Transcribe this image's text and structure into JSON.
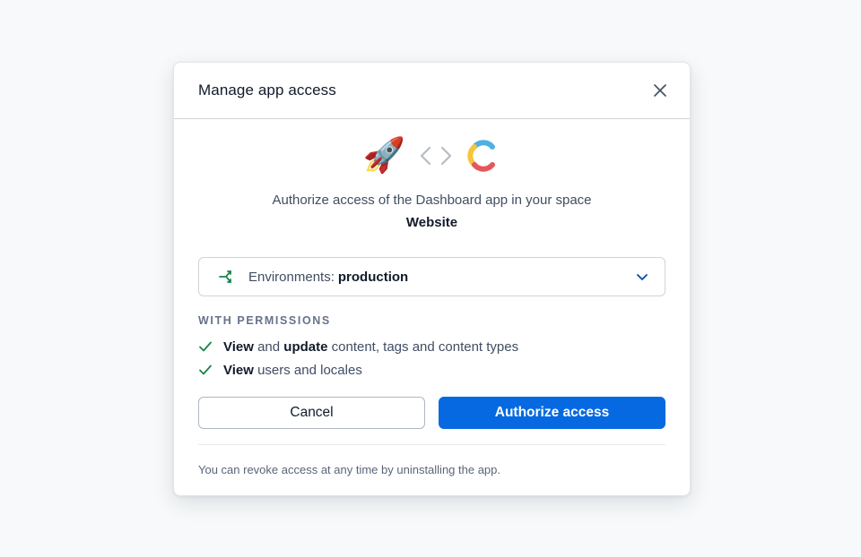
{
  "modal": {
    "title": "Manage app access",
    "close_icon": "close-icon"
  },
  "logos": {
    "app_icon": "rocket-icon",
    "app_glyph": "🚀",
    "link_icon": "code-brackets-icon",
    "space_icon": "contentful-logo-icon"
  },
  "authorize": {
    "text": "Authorize access of the Dashboard app in your space",
    "space_name": "Website"
  },
  "environment": {
    "label": "Environments:",
    "value": "production",
    "icon": "environment-branch-icon",
    "chevron": "chevron-down-icon"
  },
  "permissions": {
    "heading": "With permissions",
    "items": [
      {
        "strong1": "View",
        "text1": " and ",
        "strong2": "update",
        "text2": " content, tags and content types"
      },
      {
        "strong1": "View",
        "text1": " users and locales",
        "strong2": "",
        "text2": ""
      }
    ]
  },
  "buttons": {
    "cancel_label": "Cancel",
    "authorize_label": "Authorize access"
  },
  "footer": {
    "note": "You can revoke access at any time by uninstalling the app."
  },
  "colors": {
    "primary": "#0669e1",
    "success": "#14874a",
    "text": "#111b2b",
    "muted": "#414d63"
  }
}
